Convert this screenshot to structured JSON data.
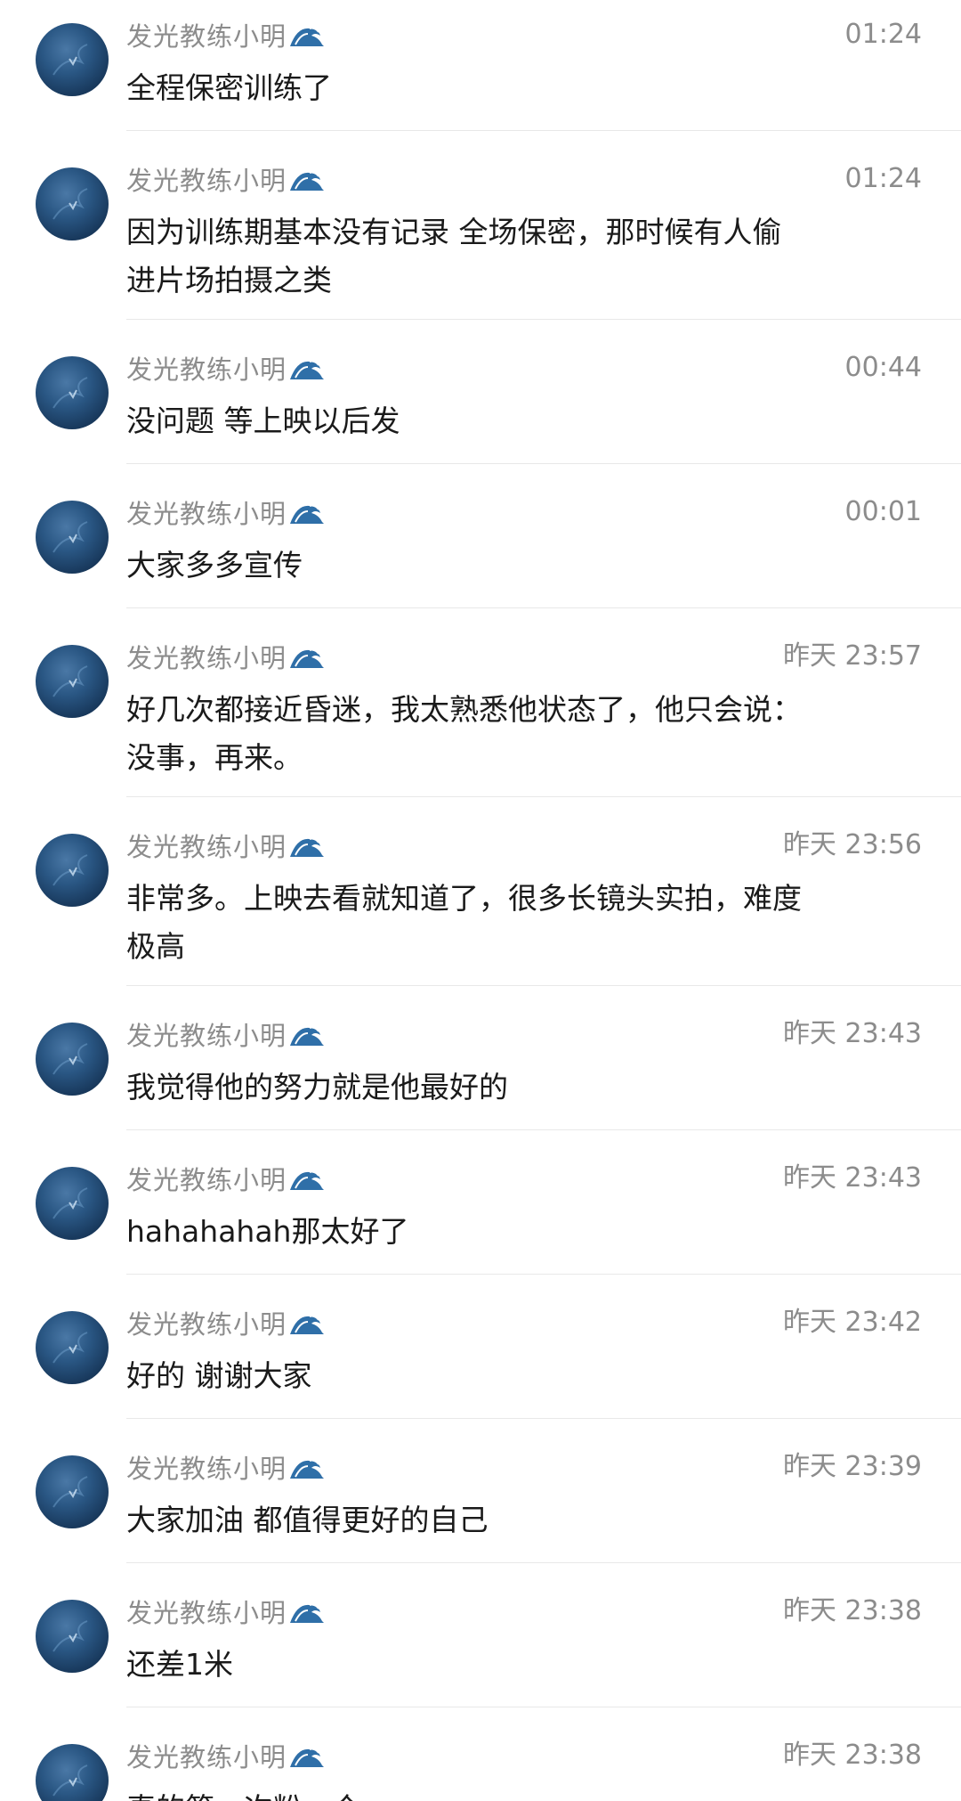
{
  "messages": [
    {
      "sender": "发光教练小明",
      "time": "01:24",
      "text": "全程保密训练了"
    },
    {
      "sender": "发光教练小明",
      "time": "01:24",
      "text": "因为训练期基本没有记录 全场保密，那时候有人偷进片场拍摄之类"
    },
    {
      "sender": "发光教练小明",
      "time": "00:44",
      "text": "没问题 等上映以后发"
    },
    {
      "sender": "发光教练小明",
      "time": "00:01",
      "text": "大家多多宣传"
    },
    {
      "sender": "发光教练小明",
      "time": "昨天 23:57",
      "text": "好几次都接近昏迷，我太熟悉他状态了，他只会说：没事，再来。"
    },
    {
      "sender": "发光教练小明",
      "time": "昨天 23:56",
      "text": "非常多。上映去看就知道了，很多长镜头实拍，难度极高"
    },
    {
      "sender": "发光教练小明",
      "time": "昨天 23:43",
      "text": "我觉得他的努力就是他最好的"
    },
    {
      "sender": "发光教练小明",
      "time": "昨天 23:43",
      "text": "hahahahah那太好了"
    },
    {
      "sender": "发光教练小明",
      "time": "昨天 23:42",
      "text": "好的 谢谢大家"
    },
    {
      "sender": "发光教练小明",
      "time": "昨天 23:39",
      "text": "大家加油 都值得更好的自己"
    },
    {
      "sender": "发光教练小明",
      "time": "昨天 23:38",
      "text": "还差1米"
    },
    {
      "sender": "发光教练小明",
      "time": "昨天 23:38",
      "text": "真的第一次粉一个"
    }
  ],
  "icons": {
    "avatar": "avatar-image",
    "name_suffix": "wave-emoji-icon"
  },
  "colors": {
    "meta_text": "#8c8c8c",
    "message_text": "#1a1a1a",
    "divider": "#e8e8e8",
    "avatar_blue": "#2a5784"
  }
}
